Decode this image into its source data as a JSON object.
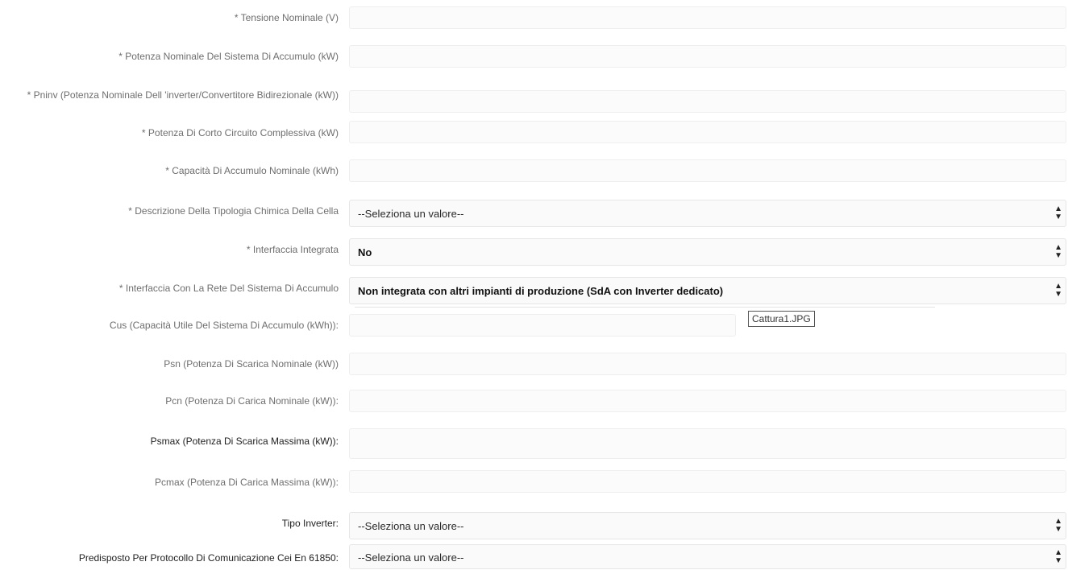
{
  "form": {
    "fields": [
      {
        "label": "* Tensione Nominale (V)"
      },
      {
        "label": "* Potenza Nominale Del Sistema Di Accumulo (kW)"
      },
      {
        "label": "* Pninv (Potenza Nominale Dell 'inverter/Convertitore Bidirezionale (kW))"
      },
      {
        "label": "* Potenza Di Corto Circuito Complessiva (kW)"
      },
      {
        "label": "* Capacità Di Accumulo Nominale (kWh)"
      },
      {
        "label": "* Descrizione Della Tipologia Chimica Della Cella",
        "value": "--Seleziona un valore--"
      },
      {
        "label": "* Interfaccia Integrata",
        "value": "No"
      },
      {
        "label": "* Interfaccia Con La Rete Del Sistema Di Accumulo",
        "value": "Non integrata con altri impianti di produzione (SdA con Inverter dedicato)"
      },
      {
        "label": "Cus (Capacità Utile Del Sistema Di Accumulo (kWh)):"
      },
      {
        "label": "Psn (Potenza Di Scarica Nominale (kW))"
      },
      {
        "label": "Pcn (Potenza Di Carica Nominale (kW)):"
      },
      {
        "label": "Psmax (Potenza Di Scarica Massima (kW)):"
      },
      {
        "label": "Pcmax (Potenza Di Carica Massima (kW)):"
      },
      {
        "label": "Tipo Inverter:",
        "value": "--Seleziona un valore--"
      },
      {
        "label": "Predisposto Per Protocollo Di Comunicazione Cei En 61850:",
        "value": "--Seleziona un valore--"
      }
    ]
  },
  "tooltip": {
    "text": "Cattura1.JPG"
  },
  "icons": {
    "select_arrows": "updown-arrows-icon"
  }
}
